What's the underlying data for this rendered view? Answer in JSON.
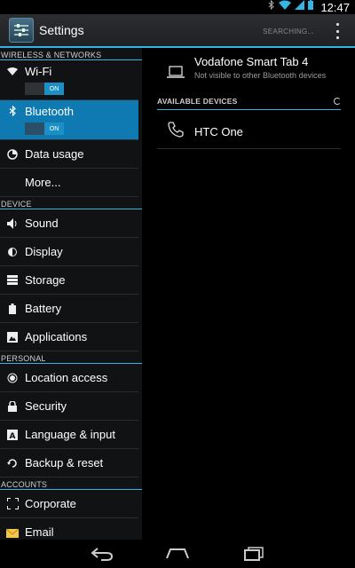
{
  "statusbar": {
    "time": "12:47",
    "icons": [
      "bluetooth-icon",
      "wifi-icon",
      "signal-icon",
      "battery-icon"
    ]
  },
  "actionbar": {
    "title": "Settings",
    "status": "SEARCHING..."
  },
  "sidebar": {
    "section_wireless": "WIRELESS & NETWORKS",
    "wifi": {
      "label": "Wi-Fi",
      "toggle": "ON"
    },
    "bluetooth": {
      "label": "Bluetooth",
      "toggle": "ON"
    },
    "data_usage": "Data usage",
    "more": "More...",
    "section_device": "DEVICE",
    "sound": "Sound",
    "display": "Display",
    "storage": "Storage",
    "battery": "Battery",
    "applications": "Applications",
    "section_personal": "PERSONAL",
    "location": "Location access",
    "security": "Security",
    "language": "Language & input",
    "backup": "Backup & reset",
    "section_accounts": "ACCOUNTS",
    "corporate": "Corporate",
    "email": "Email"
  },
  "bluetooth_panel": {
    "paired_name": "Vodafone Smart  Tab 4",
    "paired_status": "Not visible to other Bluetooth devices",
    "available_header": "AVAILABLE DEVICES",
    "devices": [
      "HTC One"
    ]
  },
  "colors": {
    "accent": "#33b5e5",
    "selected": "#0f7ab2"
  }
}
